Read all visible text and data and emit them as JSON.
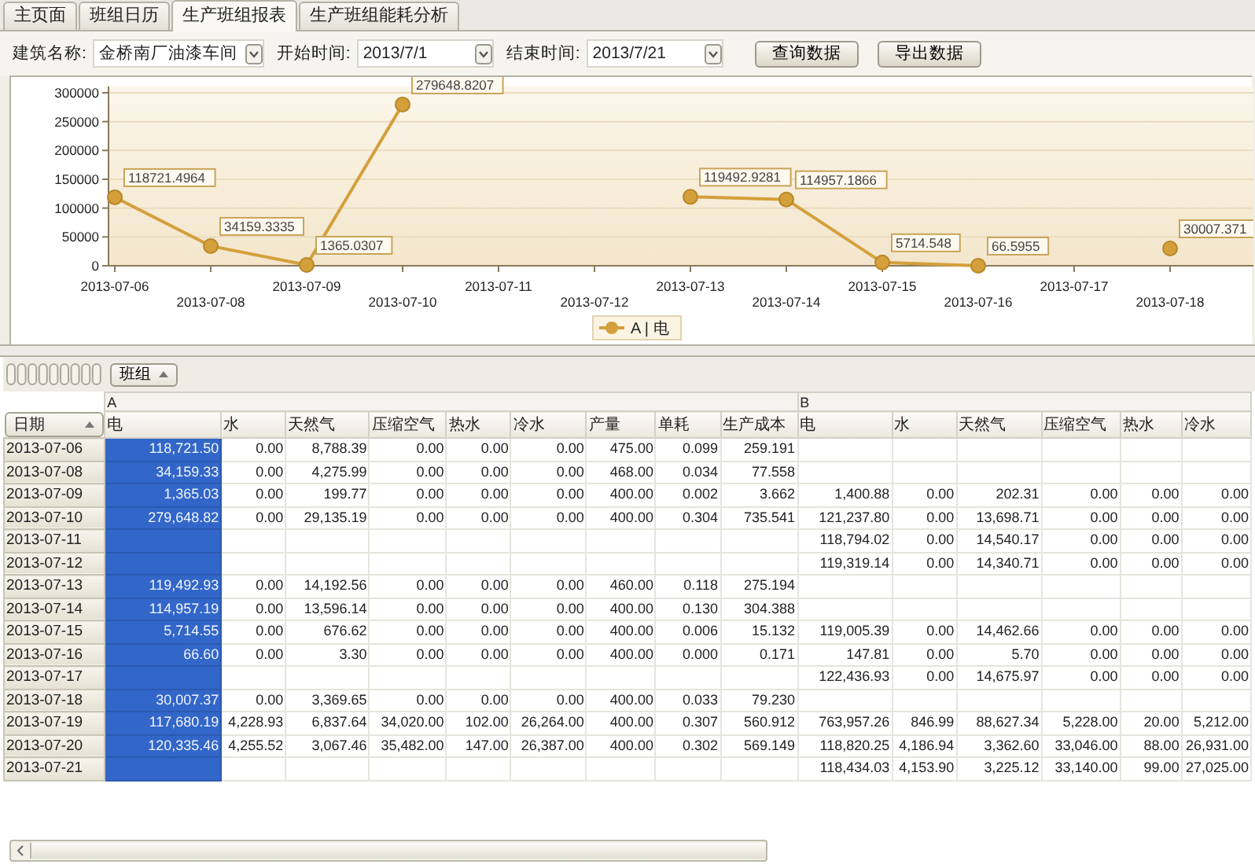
{
  "tabs": [
    {
      "label": "主页面",
      "selected": false
    },
    {
      "label": "班组日历",
      "selected": false
    },
    {
      "label": "生产班组报表",
      "selected": true
    },
    {
      "label": "生产班组能耗分析",
      "selected": false
    }
  ],
  "filters": [
    {
      "label": "建筑名称:",
      "value": "金桥南厂油漆车间"
    },
    {
      "label": "开始时间:",
      "value": "2013/7/1"
    },
    {
      "label": "结束时间:",
      "value": "2013/7/21"
    }
  ],
  "buttons": [
    "查询数据",
    "导出数据"
  ],
  "chart": {
    "chart_data": {
      "type": "line",
      "categories": [
        "2013-07-06",
        "2013-07-08",
        "2013-07-09",
        "2013-07-10",
        "2013-07-11",
        "2013-07-12",
        "2013-07-13",
        "2013-07-14",
        "2013-07-15",
        "2013-07-16",
        "2013-07-17",
        "2013-07-18"
      ],
      "series": [
        {
          "name": "A | 电",
          "color": "#d4a03c",
          "marker": "circle",
          "values": [
            118721.4964,
            34159.3335,
            1365.0307,
            279648.8207,
            null,
            null,
            119492.9281,
            114957.1866,
            5714.548,
            66.5955,
            null,
            30007.371
          ]
        }
      ],
      "ylim": [
        0,
        300000
      ],
      "yticks": [
        0,
        50000,
        100000,
        150000,
        200000,
        250000,
        300000
      ],
      "data_labels": true,
      "grid": true
    }
  },
  "grid": {
    "group_button": "班组",
    "date_header": "日期",
    "groups": [
      {
        "name": "A",
        "columns": [
          {
            "label": "电",
            "selected": true
          },
          {
            "label": "水",
            "selected": false
          },
          {
            "label": "天然气",
            "selected": false
          },
          {
            "label": "压缩空气",
            "selected": false
          },
          {
            "label": "热水",
            "selected": false
          },
          {
            "label": "冷水",
            "selected": false
          },
          {
            "label": "产量",
            "selected": false
          },
          {
            "label": "单耗",
            "selected": false
          },
          {
            "label": "生产成本",
            "selected": false
          }
        ]
      },
      {
        "name": "B",
        "columns": [
          {
            "label": "电",
            "selected": false
          },
          {
            "label": "水",
            "selected": false
          },
          {
            "label": "天然气",
            "selected": false
          },
          {
            "label": "压缩空气",
            "selected": false
          },
          {
            "label": "热水",
            "selected": false
          },
          {
            "label": "冷水",
            "selected": false
          }
        ]
      }
    ],
    "rows": [
      {
        "date": "2013-07-06",
        "cells": [
          "118,721.50",
          "0.00",
          "8,788.39",
          "0.00",
          "0.00",
          "0.00",
          "475.00",
          "0.099",
          "259.191",
          null,
          null,
          null,
          null,
          null,
          null
        ]
      },
      {
        "date": "2013-07-08",
        "cells": [
          "34,159.33",
          "0.00",
          "4,275.99",
          "0.00",
          "0.00",
          "0.00",
          "468.00",
          "0.034",
          "77.558",
          null,
          null,
          null,
          null,
          null,
          null
        ]
      },
      {
        "date": "2013-07-09",
        "cells": [
          "1,365.03",
          "0.00",
          "199.77",
          "0.00",
          "0.00",
          "0.00",
          "400.00",
          "0.002",
          "3.662",
          "1,400.88",
          "0.00",
          "202.31",
          "0.00",
          "0.00",
          "0.00"
        ]
      },
      {
        "date": "2013-07-10",
        "cells": [
          "279,648.82",
          "0.00",
          "29,135.19",
          "0.00",
          "0.00",
          "0.00",
          "400.00",
          "0.304",
          "735.541",
          "121,237.80",
          "0.00",
          "13,698.71",
          "0.00",
          "0.00",
          "0.00"
        ]
      },
      {
        "date": "2013-07-11",
        "cells": [
          null,
          null,
          null,
          null,
          null,
          null,
          null,
          null,
          null,
          "118,794.02",
          "0.00",
          "14,540.17",
          "0.00",
          "0.00",
          "0.00"
        ]
      },
      {
        "date": "2013-07-12",
        "cells": [
          null,
          null,
          null,
          null,
          null,
          null,
          null,
          null,
          null,
          "119,319.14",
          "0.00",
          "14,340.71",
          "0.00",
          "0.00",
          "0.00"
        ]
      },
      {
        "date": "2013-07-13",
        "cells": [
          "119,492.93",
          "0.00",
          "14,192.56",
          "0.00",
          "0.00",
          "0.00",
          "460.00",
          "0.118",
          "275.194",
          null,
          null,
          null,
          null,
          null,
          null
        ]
      },
      {
        "date": "2013-07-14",
        "cells": [
          "114,957.19",
          "0.00",
          "13,596.14",
          "0.00",
          "0.00",
          "0.00",
          "400.00",
          "0.130",
          "304.388",
          null,
          null,
          null,
          null,
          null,
          null
        ]
      },
      {
        "date": "2013-07-15",
        "cells": [
          "5,714.55",
          "0.00",
          "676.62",
          "0.00",
          "0.00",
          "0.00",
          "400.00",
          "0.006",
          "15.132",
          "119,005.39",
          "0.00",
          "14,462.66",
          "0.00",
          "0.00",
          "0.00"
        ]
      },
      {
        "date": "2013-07-16",
        "cells": [
          "66.60",
          "0.00",
          "3.30",
          "0.00",
          "0.00",
          "0.00",
          "400.00",
          "0.000",
          "0.171",
          "147.81",
          "0.00",
          "5.70",
          "0.00",
          "0.00",
          "0.00"
        ]
      },
      {
        "date": "2013-07-17",
        "cells": [
          null,
          null,
          null,
          null,
          null,
          null,
          null,
          null,
          null,
          "122,436.93",
          "0.00",
          "14,675.97",
          "0.00",
          "0.00",
          "0.00"
        ]
      },
      {
        "date": "2013-07-18",
        "cells": [
          "30,007.37",
          "0.00",
          "3,369.65",
          "0.00",
          "0.00",
          "0.00",
          "400.00",
          "0.033",
          "79.230",
          null,
          null,
          null,
          null,
          null,
          null
        ]
      },
      {
        "date": "2013-07-19",
        "cells": [
          "117,680.19",
          "4,228.93",
          "6,837.64",
          "34,020.00",
          "102.00",
          "26,264.00",
          "400.00",
          "0.307",
          "560.912",
          "763,957.26",
          "846.99",
          "88,627.34",
          "5,228.00",
          "20.00",
          "5,212.00"
        ]
      },
      {
        "date": "2013-07-20",
        "cells": [
          "120,335.46",
          "4,255.52",
          "3,067.46",
          "35,482.00",
          "147.00",
          "26,387.00",
          "400.00",
          "0.302",
          "569.149",
          "118,820.25",
          "4,186.94",
          "3,362.60",
          "33,046.00",
          "88.00",
          "26,931.00"
        ]
      },
      {
        "date": "2013-07-21",
        "cells": [
          null,
          null,
          null,
          null,
          null,
          null,
          null,
          null,
          null,
          "118,434.03",
          "4,153.90",
          "3,225.12",
          "33,140.00",
          "99.00",
          "27,025.00"
        ]
      }
    ]
  }
}
